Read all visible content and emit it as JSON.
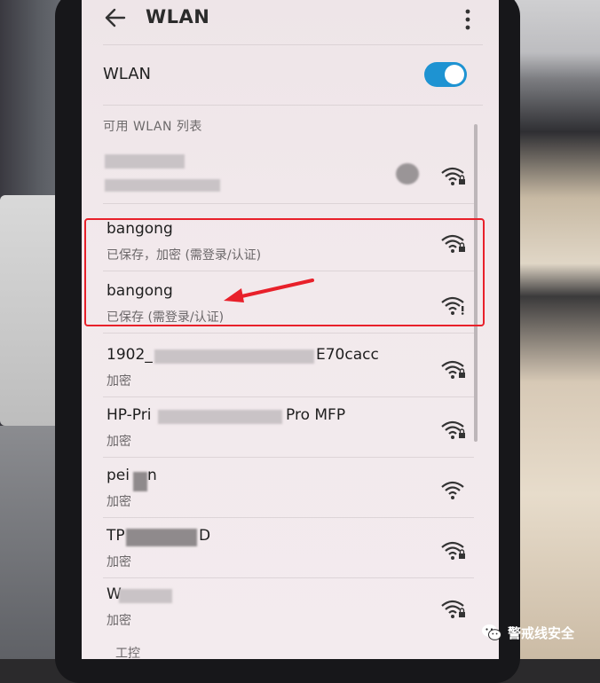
{
  "header": {
    "title": "WLAN"
  },
  "wlan_toggle": {
    "label": "WLAN",
    "on": true
  },
  "section_title": "可用 WLAN 列表",
  "networks": [
    {
      "name": "",
      "status": "",
      "secured": true
    },
    {
      "name": "bangong",
      "status": "已保存，加密 (需登录/认证)",
      "secured": true
    },
    {
      "name": "bangong",
      "status": "已保存 (需登录/认证)",
      "secured": false,
      "warning": true
    },
    {
      "name": "1902_",
      "name_suffix": "E70cacc",
      "status": "加密",
      "secured": true
    },
    {
      "name": "HP-Pri",
      "name_suffix": "Pro MFP",
      "status": "加密",
      "secured": true
    },
    {
      "name": "pei",
      "name_suffix": "n",
      "status": "加密",
      "secured": false
    },
    {
      "name": "TP",
      "name_suffix": "D",
      "status": "加密",
      "secured": true
    },
    {
      "name": "W",
      "status": "加密",
      "secured": true
    }
  ],
  "cutoff_item": "工控",
  "watermark": {
    "text": "警戒线安全"
  },
  "colors": {
    "accent": "#1e93d2",
    "highlight": "#e8202a"
  },
  "icons": [
    "back-arrow-icon",
    "more-vert-icon",
    "wifi-lock-icon",
    "wifi-warning-icon",
    "wechat-icon"
  ]
}
